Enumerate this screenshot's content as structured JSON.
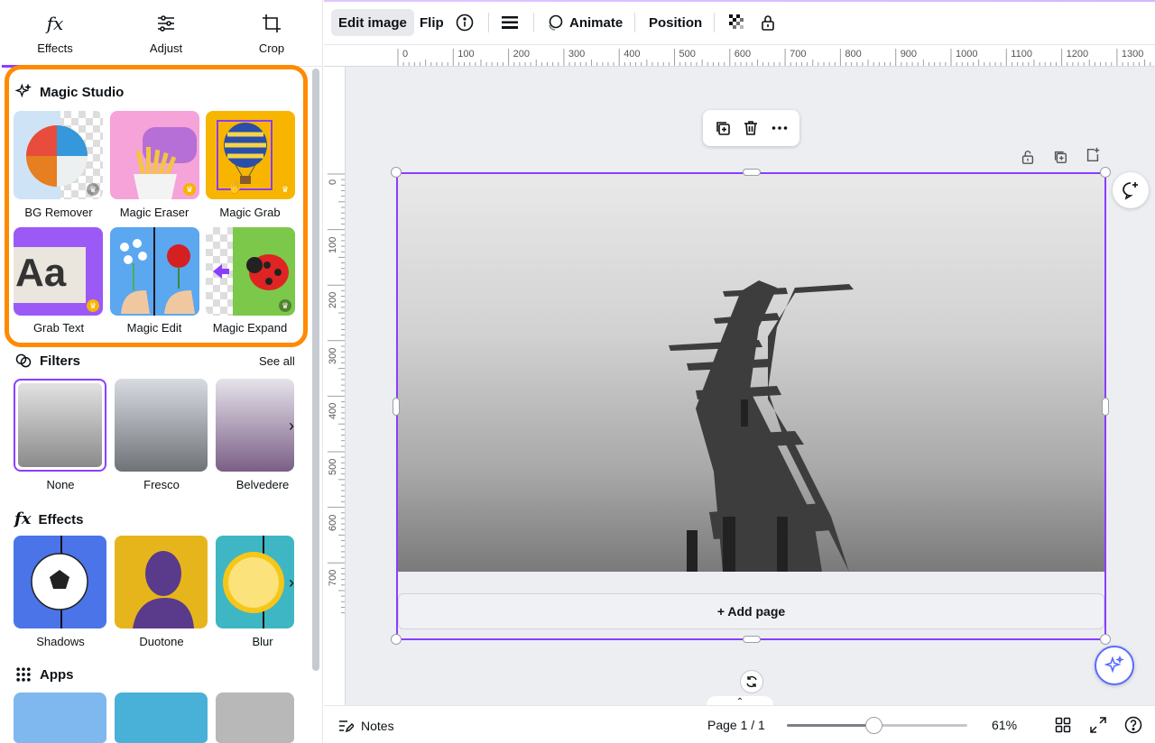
{
  "panel_tabs": {
    "effects": "Effects",
    "adjust": "Adjust",
    "crop": "Crop"
  },
  "magic_studio": {
    "title": "Magic Studio",
    "items": [
      {
        "label": "BG Remover",
        "premium": true
      },
      {
        "label": "Magic Eraser",
        "premium": true
      },
      {
        "label": "Magic Grab",
        "premium": true
      },
      {
        "label": "Grab Text",
        "premium": true
      },
      {
        "label": "Magic Edit",
        "premium": false
      },
      {
        "label": "Magic Expand",
        "premium": true
      }
    ],
    "grab_text_sample": "Aa"
  },
  "filters": {
    "title": "Filters",
    "see_all": "See all",
    "items": [
      {
        "label": "None",
        "selected": true
      },
      {
        "label": "Fresco",
        "selected": false
      },
      {
        "label": "Belvedere",
        "selected": false
      }
    ]
  },
  "effects": {
    "title": "Effects",
    "items": [
      {
        "label": "Shadows"
      },
      {
        "label": "Duotone"
      },
      {
        "label": "Blur"
      }
    ]
  },
  "apps": {
    "title": "Apps"
  },
  "toolbar": {
    "edit_image": "Edit image",
    "flip": "Flip",
    "animate": "Animate",
    "position": "Position"
  },
  "ruler": {
    "top": [
      "0",
      "100",
      "200",
      "300",
      "400",
      "500",
      "600",
      "700",
      "800",
      "900",
      "1000",
      "1100",
      "1200",
      "1300"
    ],
    "left": [
      "0",
      "100",
      "200",
      "300",
      "400",
      "500",
      "600",
      "700"
    ]
  },
  "canvas": {
    "add_page": "+ Add page"
  },
  "bottombar": {
    "notes": "Notes",
    "page": "Page 1 / 1",
    "zoom": "61%",
    "zoom_value": 61
  },
  "colors": {
    "accent": "#8b3dff",
    "highlight": "#ff8a00",
    "magic": "#5a6bff"
  }
}
